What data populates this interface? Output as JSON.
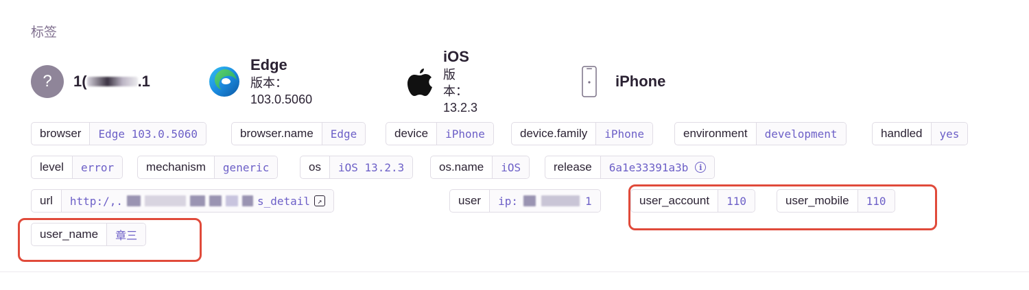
{
  "section_title": "标签",
  "contexts": {
    "ip": {
      "text": "1(",
      "suffix": ".1",
      "icon": "question-mark-icon"
    },
    "browser": {
      "name": "Edge",
      "version_label": "版本：",
      "version": "103.0.5060",
      "icon": "edge-logo-icon"
    },
    "os": {
      "name": "iOS",
      "version_label": "版本：",
      "version": "13.2.3",
      "icon": "apple-logo-icon"
    },
    "device": {
      "name": "iPhone",
      "icon": "phone-icon"
    }
  },
  "tags": {
    "browser": {
      "key": "browser",
      "value": "Edge 103.0.5060"
    },
    "browser_name": {
      "key": "browser.name",
      "value": "Edge"
    },
    "device": {
      "key": "device",
      "value": "iPhone"
    },
    "device_family": {
      "key": "device.family",
      "value": "iPhone"
    },
    "environment": {
      "key": "environment",
      "value": "development"
    },
    "handled": {
      "key": "handled",
      "value": "yes"
    },
    "level": {
      "key": "level",
      "value": "error"
    },
    "mechanism": {
      "key": "mechanism",
      "value": "generic"
    },
    "os": {
      "key": "os",
      "value": "iOS 13.2.3"
    },
    "os_name": {
      "key": "os.name",
      "value": "iOS"
    },
    "release": {
      "key": "release",
      "value": "6a1e33391a3b"
    },
    "url": {
      "key": "url",
      "value_prefix": "http:/,.",
      "value_suffix": "s_detail"
    },
    "user": {
      "key": "user",
      "value_prefix": "ip:",
      "value_suffix": "1"
    },
    "user_account": {
      "key": "user_account",
      "value": "110"
    },
    "user_mobile": {
      "key": "user_mobile",
      "value": "110"
    },
    "user_name": {
      "key": "user_name",
      "value": "章三"
    }
  },
  "colors": {
    "accent": "#6c5fc7",
    "highlight": "#e04a3a",
    "border": "#e0dce5",
    "text": "#2b2233"
  }
}
